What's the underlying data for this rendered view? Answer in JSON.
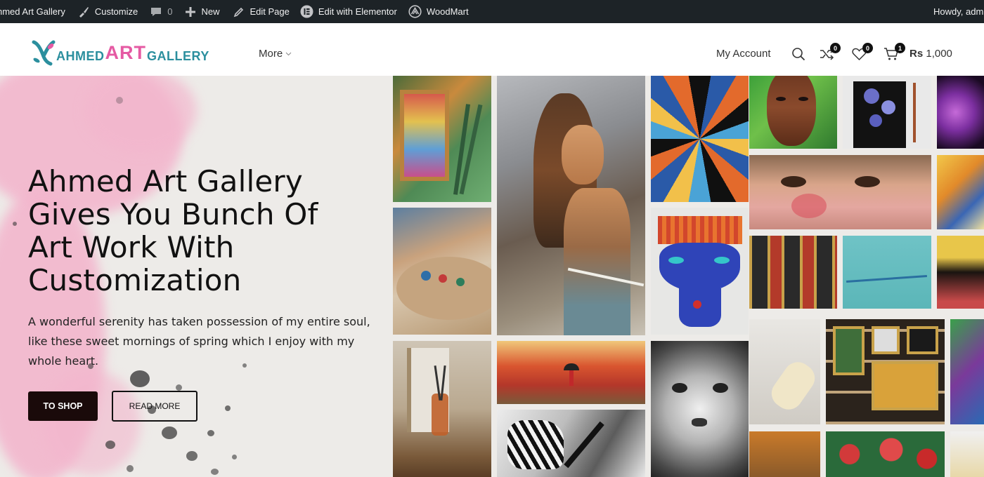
{
  "admin_bar": {
    "site_name": "hmed Art Gallery",
    "customize": "Customize",
    "comments_count": "0",
    "new": "New",
    "edit_page": "Edit Page",
    "edit_elementor": "Edit with Elementor",
    "woodmart": "WoodMart",
    "howdy": "Howdy, adm"
  },
  "header": {
    "logo": {
      "part1": "AHMED",
      "part2": "ART",
      "part3": "GALLERY"
    },
    "nav_more": "More",
    "my_account": "My Account",
    "compare_count": "0",
    "wishlist_count": "0",
    "cart_count": "1",
    "cart_currency": "Rs",
    "cart_amount": "1,000"
  },
  "hero": {
    "title": "Ahmed Art Gallery Gives You Bunch Of Art Work With Customization",
    "text": "A wonderful serenity has taken possession of my entire soul, like these sweet mornings of spring which I enjoy with my whole heart.",
    "btn_shop": "TO SHOP",
    "btn_read": "READ MORE"
  },
  "colors": {
    "admin_bar_bg": "#1d2327",
    "logo_teal": "#2b8f9e",
    "logo_pink": "#e55aa3",
    "button_dark": "#1a0a0a",
    "hero_bg": "#edebe8"
  }
}
